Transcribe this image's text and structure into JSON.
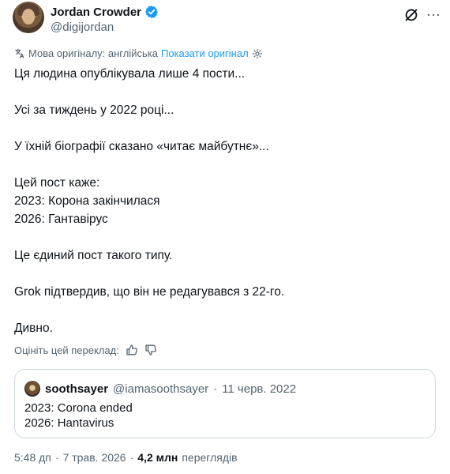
{
  "author": {
    "display_name": "Jordan Crowder",
    "handle": "@digijordan",
    "verified": true
  },
  "translation": {
    "label": "Мова оригіналу: англійська",
    "show_original": "Показати оригінал"
  },
  "body": {
    "lines": [
      "Ця людина опублікувала лише 4 пости...",
      "Усі за тиждень у 2022 році...",
      "У їхній біографії сказано «читає майбутнє»...",
      "Цей пост каже:",
      "2023: Корона закінчилася",
      "2026: Гантавірус",
      "Це єдиний пост такого типу.",
      "Grok підтвердив, що він не редагувався з 22-го.",
      "Дивно."
    ]
  },
  "rate_translation": {
    "label": "Оцініть цей переклад:"
  },
  "quote": {
    "display_name": "soothsayer",
    "handle": "@iamasoothsayer",
    "separator": "·",
    "date": "11 черв. 2022",
    "lines": [
      "2023: Corona ended",
      "2026: Hantavirus"
    ]
  },
  "footer": {
    "time": "5:48 дп",
    "separator": "·",
    "date": "7 трав. 2026",
    "views_count": "4,2 млн",
    "views_label": "переглядів"
  },
  "colors": {
    "accent": "#1d9bf0",
    "text": "#0f1419",
    "muted": "#536471",
    "border": "#cfd9de"
  },
  "icons": [
    "verified-badge-icon",
    "grok-icon",
    "more-icon",
    "translate-icon",
    "settings-icon",
    "thumbs-up-icon",
    "thumbs-down-icon"
  ]
}
